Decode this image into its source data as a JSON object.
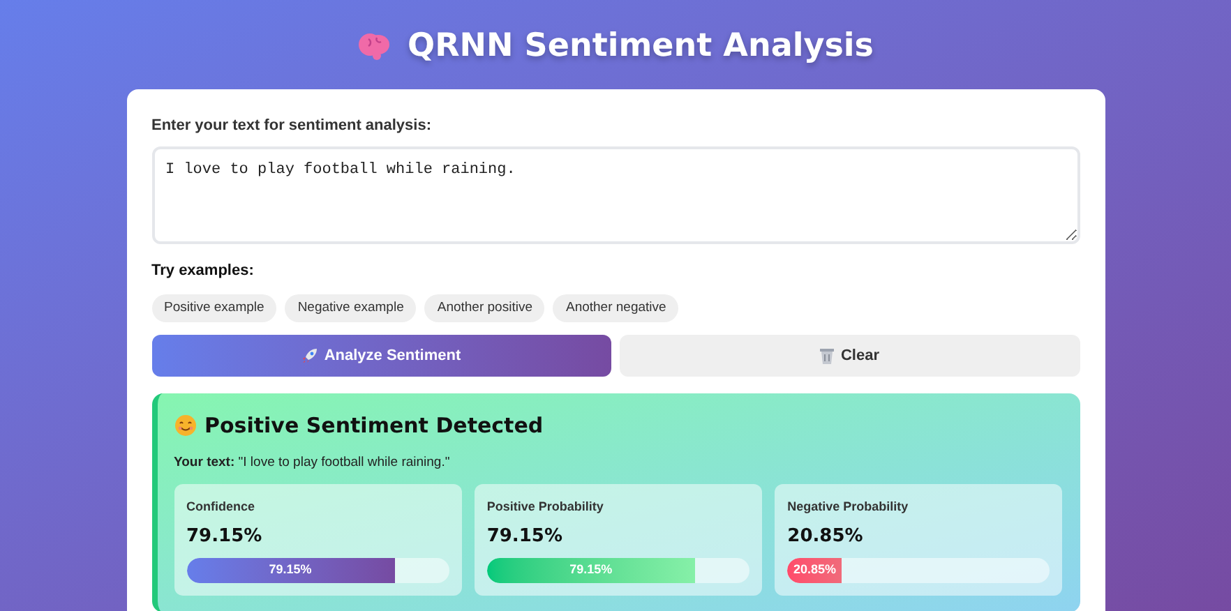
{
  "title": "QRNN Sentiment Analysis",
  "input": {
    "label": "Enter your text for sentiment analysis:",
    "value": "I love to play football while raining."
  },
  "examples": {
    "label": "Try examples:",
    "items": [
      "Positive example",
      "Negative example",
      "Another positive",
      "Another negative"
    ]
  },
  "buttons": {
    "analyze": "Analyze Sentiment",
    "clear": "Clear"
  },
  "result": {
    "heading": "Positive Sentiment Detected",
    "text_label": "Your text:",
    "text": "\"I love to play football while raining.\"",
    "metrics": [
      {
        "kind": "confidence",
        "label": "Confidence",
        "value": "79.15%",
        "level": 0.7915,
        "bar_label": "79.15%"
      },
      {
        "kind": "positive",
        "label": "Positive Probability",
        "value": "79.15%",
        "level": 0.7915,
        "bar_label": "79.15%"
      },
      {
        "kind": "negative",
        "label": "Negative Probability",
        "value": "20.85%",
        "level": 0.2085,
        "bar_label": "20.85%"
      }
    ]
  }
}
